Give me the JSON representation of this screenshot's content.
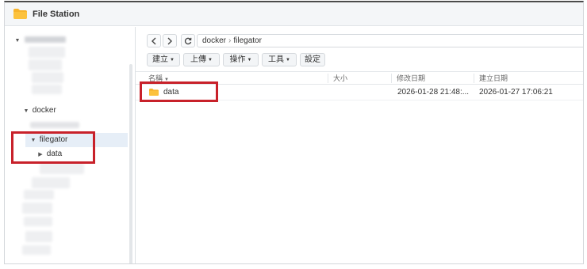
{
  "window": {
    "title": "File Station",
    "icon": "folder-icon",
    "colors": {
      "accent_folder": "#f7b32b",
      "highlight": "#c8212a",
      "selected_row": "#e6eef7"
    }
  },
  "sidebar": {
    "items": [
      {
        "label": "docker",
        "expanded": true
      },
      {
        "label": "filegator",
        "expanded": true,
        "selected": true
      },
      {
        "label": "data",
        "expanded": false
      }
    ]
  },
  "toolbar": {
    "back_icon": "chevron-left-icon",
    "forward_icon": "chevron-right-icon",
    "refresh_icon": "refresh-icon",
    "path": [
      "docker",
      "filegator"
    ],
    "buttons": [
      {
        "label": "建立",
        "dropdown": true
      },
      {
        "label": "上傳",
        "dropdown": true
      },
      {
        "label": "操作",
        "dropdown": true
      },
      {
        "label": "工具",
        "dropdown": true
      },
      {
        "label": "設定",
        "dropdown": false
      }
    ]
  },
  "table": {
    "columns": [
      "名稱",
      "大小",
      "修改日期",
      "建立日期"
    ],
    "sort_column": "名稱",
    "rows": [
      {
        "name": "data",
        "size": "",
        "modified": "2026-01-28 21:48:...",
        "created": "2026-01-27 17:06:21",
        "type": "folder"
      }
    ]
  }
}
